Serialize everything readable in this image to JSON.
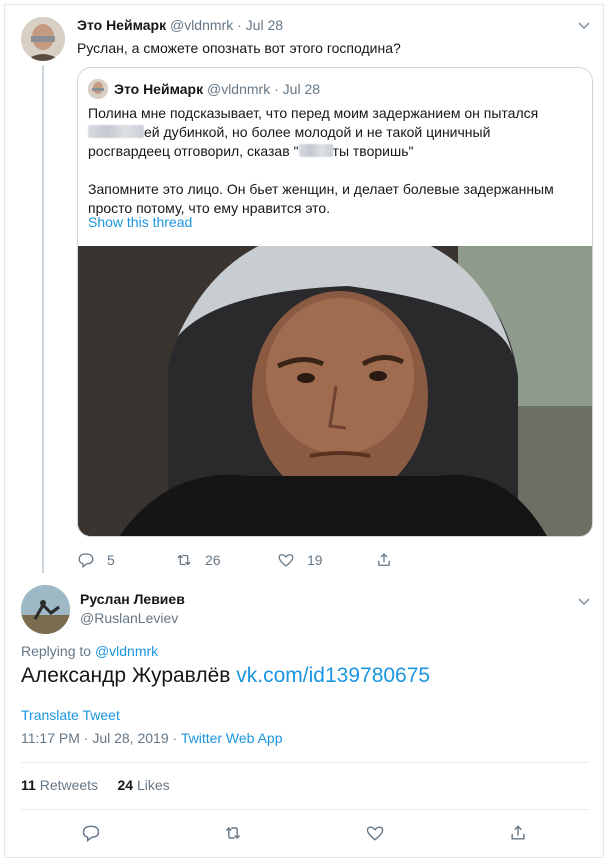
{
  "parent_tweet": {
    "author_name": "Это Неймарк",
    "handle": "@vldnmrk",
    "date": "Jul 28",
    "text": "Руслан, а сможете опознать вот этого господина?",
    "stats": {
      "replies": "5",
      "retweets": "26",
      "likes": "19"
    }
  },
  "quoted_tweet": {
    "author_name": "Это Неймарк",
    "handle": "@vldnmrk",
    "date": "Jul 28",
    "line1": "Полина мне подсказывает, что перед моим задержанием он пытался",
    "line2_after": "ей дубинкой, но более молодой и не такой циничный",
    "line3_before": "росгвардеец отговорил, сказав \"",
    "line3_after": "ты творишь\"",
    "para2": "Запомните это лицо. Он бьет женщин, и делает болевые задержанным просто потому, что ему нравится это.",
    "show_thread": "Show this thread"
  },
  "main_tweet": {
    "author_name": "Руслан Левиев",
    "handle": "@RuslanLeviev",
    "replying_prefix": "Replying to",
    "replying_to": "@vldnmrk",
    "text": "Александр Журавлёв",
    "link": "vk.com/id139780675",
    "translate": "Translate Tweet",
    "timestamp": "11:17 PM · Jul 28, 2019 ·",
    "source": "Twitter Web App",
    "retweets_count": "11",
    "retweets_label": "Retweets",
    "likes_count": "24",
    "likes_label": "Likes"
  },
  "colors": {
    "link": "#1b95e0",
    "muted": "#657786",
    "border": "#e1e8ed"
  },
  "icons": [
    "chevron-down-icon",
    "reply-icon",
    "retweet-icon",
    "like-icon",
    "share-icon"
  ]
}
